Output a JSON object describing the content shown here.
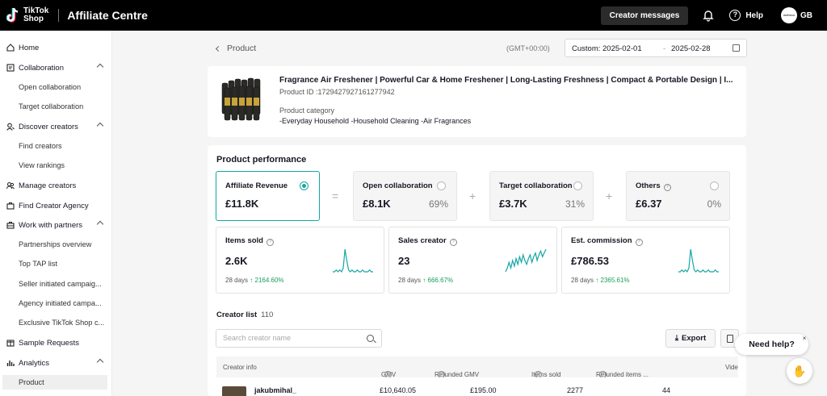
{
  "header": {
    "logo_line1": "TikTok",
    "logo_line2": "Shop",
    "app_title": "Affiliate Centre",
    "creator_messages": "Creator messages",
    "help": "Help",
    "avatar_text": "mebeco",
    "avatar_initials": "GB"
  },
  "sidebar": {
    "items": [
      {
        "label": "Home",
        "icon": "home-icon"
      },
      {
        "label": "Collaboration",
        "icon": "collaboration-icon",
        "expanded": true
      },
      {
        "label": "Open collaboration"
      },
      {
        "label": "Target collaboration"
      },
      {
        "label": "Discover creators",
        "icon": "discover-icon",
        "expanded": true
      },
      {
        "label": "Find creators"
      },
      {
        "label": "View rankings"
      },
      {
        "label": "Manage creators",
        "icon": "manage-icon"
      },
      {
        "label": "Find Creator Agency",
        "icon": "agency-icon"
      },
      {
        "label": "Work with partners",
        "icon": "partners-icon",
        "expanded": true
      },
      {
        "label": "Partnerships overview"
      },
      {
        "label": "Top TAP list"
      },
      {
        "label": "Seller initiated campaig..."
      },
      {
        "label": "Agency initiated campa..."
      },
      {
        "label": "Exclusive TikTok Shop c..."
      },
      {
        "label": "Sample Requests",
        "icon": "sample-icon"
      },
      {
        "label": "Analytics",
        "icon": "analytics-icon",
        "expanded": true
      },
      {
        "label": "Product",
        "active": true
      }
    ]
  },
  "breadcrumb": {
    "label": "Product"
  },
  "date": {
    "timezone": "(GMT+00:00)",
    "range_prefix": "Custom: 2025-02-01",
    "dash": "-",
    "end": "2025-02-28"
  },
  "product": {
    "title": "Fragrance Air Freshener | Powerful Car & Home Freshener | Long-Lasting Freshness | Compact & Portable Design | I...",
    "id": "Product ID :1729427927161277942",
    "category_label": "Product category",
    "category": "-Everyday Household  -Household Cleaning  -Air Fragrances"
  },
  "performance": {
    "title": "Product performance",
    "affiliate": {
      "label": "Affiliate Revenue",
      "value": "£11.8K"
    },
    "open": {
      "label": "Open collaboration",
      "value": "£8.1K",
      "pct": "69%"
    },
    "target": {
      "label": "Target collaboration",
      "value": "£3.7K",
      "pct": "31%"
    },
    "others": {
      "label": "Others",
      "value": "£6.37",
      "pct": "0%"
    },
    "ops": {
      "eq": "=",
      "plus": "+"
    }
  },
  "metrics": [
    {
      "label": "Items sold",
      "value": "2.6K",
      "period": "28 days",
      "change": "2164.60%",
      "trend": [
        2,
        2,
        3,
        2,
        3,
        2,
        4,
        14,
        8,
        3,
        2,
        3,
        2,
        2,
        3,
        2,
        2,
        3,
        2,
        2,
        2,
        3,
        2,
        2
      ]
    },
    {
      "label": "Sales creator",
      "value": "23",
      "period": "28 days",
      "change": "666.67%",
      "trend": [
        3,
        5,
        8,
        5,
        9,
        6,
        10,
        7,
        11,
        8,
        12,
        9,
        7,
        10,
        12,
        8,
        11,
        13,
        9,
        12,
        14,
        11,
        13,
        15
      ]
    },
    {
      "label": "Est. commission",
      "value": "£786.53",
      "period": "28 days",
      "change": "2365.61%",
      "trend": [
        2,
        2,
        3,
        2,
        3,
        2,
        4,
        14,
        8,
        3,
        2,
        3,
        2,
        2,
        3,
        2,
        2,
        3,
        2,
        2,
        2,
        3,
        2,
        2
      ]
    }
  ],
  "creator_list": {
    "title": "Creator list",
    "count": "110",
    "search_placeholder": "Search creator name",
    "export": "Export",
    "columns": [
      "Creator info",
      "GMV",
      "Refunded GMV",
      "Items sold",
      "Refunded items ...",
      "Vide"
    ],
    "rows": [
      {
        "name": "jakubmihal_",
        "gmv": "£10,640.05",
        "refunded_gmv": "£195.00",
        "items_sold": "2277",
        "refunded_items": "44"
      }
    ]
  },
  "help_widget": {
    "label": "Need help?",
    "close": "×"
  },
  "colors": {
    "accent": "#14a7a3",
    "positive": "#1a9e5a",
    "topbar": "#000000"
  }
}
